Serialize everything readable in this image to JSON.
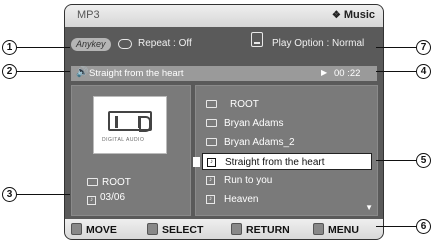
{
  "header": {
    "title": "MP3",
    "mode": "Music"
  },
  "info": {
    "anykey": "Anykey",
    "repeat": "Repeat : Off",
    "play_option": "Play Option : Normal"
  },
  "now_playing": {
    "title": "Straight from the heart",
    "time": "00 :22"
  },
  "left_panel": {
    "logo_text": "DIGITAL AUDIO",
    "folder": "ROOT",
    "count": "03/06"
  },
  "file_list": [
    {
      "label": "ROOT",
      "type": "root",
      "selected": false
    },
    {
      "label": "Bryan Adams",
      "type": "folder",
      "selected": false
    },
    {
      "label": "Bryan Adams_2",
      "type": "folder",
      "selected": false
    },
    {
      "label": "Straight from the heart",
      "type": "track",
      "selected": true
    },
    {
      "label": "Run to you",
      "type": "track",
      "selected": false
    },
    {
      "label": "Heaven",
      "type": "track",
      "selected": false
    }
  ],
  "bottom_bar": {
    "move": "MOVE",
    "select": "SELECT",
    "return": "RETURN",
    "menu": "MENU"
  },
  "callouts": {
    "c1": "1",
    "c2": "2",
    "c3": "3",
    "c4": "4",
    "c5": "5",
    "c6": "6",
    "c7": "7"
  }
}
